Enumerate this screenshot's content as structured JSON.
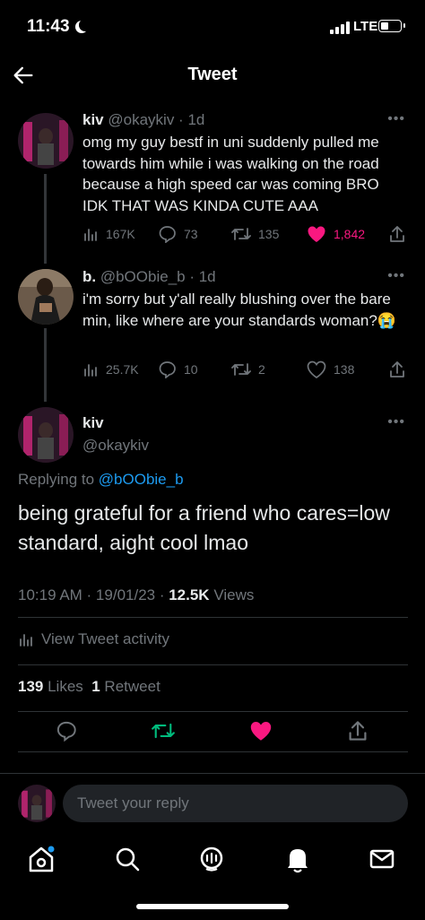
{
  "status": {
    "time": "11:43",
    "carrier": "LTE",
    "battery_level": 0.4
  },
  "header": {
    "title": "Tweet"
  },
  "thread": [
    {
      "name": "kiv",
      "handle": "@okaykiv",
      "time": "1d",
      "text": "omg my guy bestf in uni suddenly pulled me towards him while i was walking on the road because a high speed car was coming BRO IDK THAT WAS KINDA CUTE AAA",
      "views": "167K",
      "replies": "73",
      "retweets": "135",
      "likes": "1,842",
      "liked": true
    },
    {
      "name": "b.",
      "handle": "@bOObie_b",
      "time": "1d",
      "text": "i'm sorry but y'all really blushing over the bare min, like where are your standards woman?😭",
      "views": "25.7K",
      "replies": "10",
      "retweets": "2",
      "likes": "138",
      "liked": false
    }
  ],
  "main": {
    "name": "kiv",
    "handle": "@okaykiv",
    "replying_prefix": "Replying to ",
    "replying_to": "@bOObie_b",
    "text": "being grateful for a friend who cares=low standard, aight cool lmao",
    "timestamp": "10:19 AM · 19/01/23 · ",
    "views_count": "12.5K",
    "views_label": " Views",
    "activity": "View Tweet activity",
    "likes_count": "139",
    "likes_label": " Likes  ",
    "retweets_count": "1",
    "retweets_label": " Retweet"
  },
  "reply": {
    "placeholder": "Tweet your reply"
  },
  "colors": {
    "like": "#f91880",
    "retweet": "#00ba7c",
    "link": "#1d9bf0",
    "muted": "#71767b"
  },
  "icons": [
    "back-arrow-icon",
    "more-icon",
    "views-icon",
    "reply-icon",
    "retweet-icon",
    "like-icon",
    "share-icon",
    "home-icon",
    "search-icon",
    "spaces-icon",
    "notifications-icon",
    "messages-icon"
  ]
}
